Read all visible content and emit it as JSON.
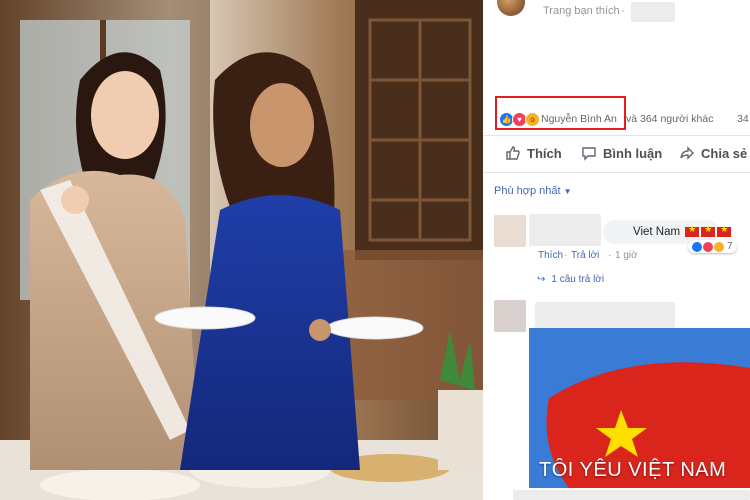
{
  "post": {
    "header_text": "Trang bạn thích",
    "reactions_summary": {
      "name": "Nguyễn Bình An",
      "others": "và 364 người khác",
      "count_tail": "34"
    },
    "actions": {
      "like": "Thích",
      "comment": "Bình luận",
      "share": "Chia sẻ"
    },
    "sort_label": "Phù hợp nhất",
    "colors": {
      "link": "#4267b2",
      "highlight_border": "#e02020"
    }
  },
  "comments": [
    {
      "text": "Viet Nam",
      "actions": {
        "like": "Thích",
        "reply": "Trả lời",
        "time": "1 giờ"
      },
      "reaction_count": "7",
      "replies_link": "1 câu trả lời"
    },
    {
      "image_caption": "TÔI YÊU VIỆT NAM",
      "image_flag_colors": {
        "red": "#da251d",
        "star": "#ffde00"
      }
    }
  ],
  "icons": [
    "like-reaction-icon",
    "love-reaction-icon",
    "wow-reaction-icon",
    "like-action-icon",
    "comment-action-icon",
    "share-action-icon",
    "reply-arrow-icon",
    "vietnam-flag-icon"
  ]
}
